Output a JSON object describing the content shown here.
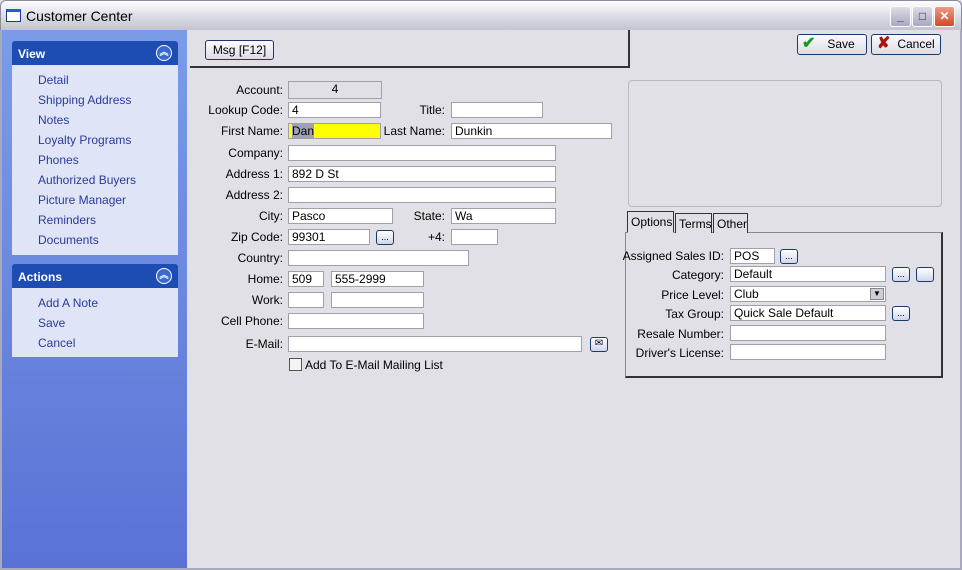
{
  "window": {
    "title": "Customer Center",
    "min": "_",
    "max": "□",
    "close": "✕"
  },
  "sidebar": {
    "view": {
      "title": "View",
      "items": [
        "Detail",
        "Shipping Address",
        "Notes",
        "Loyalty Programs",
        "Phones",
        "Authorized Buyers",
        "Picture Manager",
        "Reminders",
        "Documents"
      ]
    },
    "actions": {
      "title": "Actions",
      "items": [
        "Add A Note",
        "Save",
        "Cancel"
      ]
    }
  },
  "toolbar": {
    "msg": "Msg [F12]",
    "save": "Save",
    "cancel": "Cancel"
  },
  "form": {
    "account": {
      "label": "Account:",
      "value": "4"
    },
    "lookup": {
      "label": "Lookup Code:",
      "value": "4"
    },
    "title": {
      "label": "Title:",
      "value": ""
    },
    "first": {
      "label": "First Name:",
      "value": "Dan"
    },
    "last": {
      "label": "Last Name:",
      "value": "Dunkin"
    },
    "company": {
      "label": "Company:",
      "value": ""
    },
    "addr1": {
      "label": "Address 1:",
      "value": "892 D St"
    },
    "addr2": {
      "label": "Address 2:",
      "value": ""
    },
    "city": {
      "label": "City:",
      "value": "Pasco"
    },
    "state": {
      "label": "State:",
      "value": "Wa"
    },
    "zip": {
      "label": "Zip Code:",
      "value": "99301"
    },
    "plus4": {
      "label": "+4:",
      "value": ""
    },
    "country": {
      "label": "Country:",
      "value": ""
    },
    "home": {
      "label": "Home:",
      "area": "509",
      "number": "555-2999"
    },
    "work": {
      "label": "Work:",
      "area": "",
      "number": ""
    },
    "cell": {
      "label": "Cell Phone:",
      "value": ""
    },
    "email": {
      "label": "E-Mail:",
      "value": ""
    },
    "mailing": {
      "label": "Add To E-Mail Mailing List",
      "checked": false
    },
    "dots": "..."
  },
  "tabs": [
    "Options",
    "Terms",
    "Other"
  ],
  "options": {
    "sales": {
      "label": "Assigned Sales ID:",
      "value": "POS"
    },
    "category": {
      "label": "Category:",
      "value": "Default"
    },
    "price": {
      "label": "Price Level:",
      "value": "Club"
    },
    "tax": {
      "label": "Tax Group:",
      "value": "Quick Sale Default"
    },
    "resale": {
      "label": "Resale Number:",
      "value": ""
    },
    "license": {
      "label": "Driver's License:",
      "value": ""
    }
  },
  "colors": {
    "highlight": "#ffff00",
    "sidebar_header": "#1d4db3"
  }
}
